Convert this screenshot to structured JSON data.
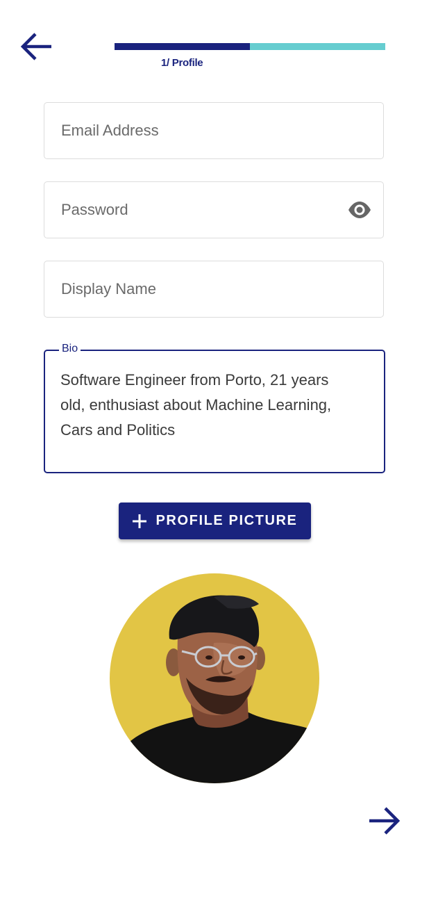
{
  "colors": {
    "primary": "#1a237e",
    "progress_remaining": "#66cdd0",
    "avatar_background": "#e2c545"
  },
  "header": {
    "back_icon": "arrow-left-icon",
    "progress": {
      "fraction": 0.5
    },
    "step_label": "1/ Profile"
  },
  "form": {
    "email": {
      "placeholder": "Email Address",
      "value": ""
    },
    "password": {
      "placeholder": "Password",
      "value": "",
      "toggle_icon": "eye-icon"
    },
    "display_name": {
      "placeholder": "Display Name",
      "value": ""
    },
    "bio": {
      "label": "Bio",
      "value": "Software Engineer from Porto, 21 years\nold, enthusiast about Machine Learning,\nCars and Politics"
    }
  },
  "profile_picture_button": {
    "icon": "plus-icon",
    "label": "PROFILE PICTURE"
  },
  "avatar": {
    "description_icon": "profile-photo"
  },
  "footer": {
    "next_icon": "arrow-right-icon"
  }
}
